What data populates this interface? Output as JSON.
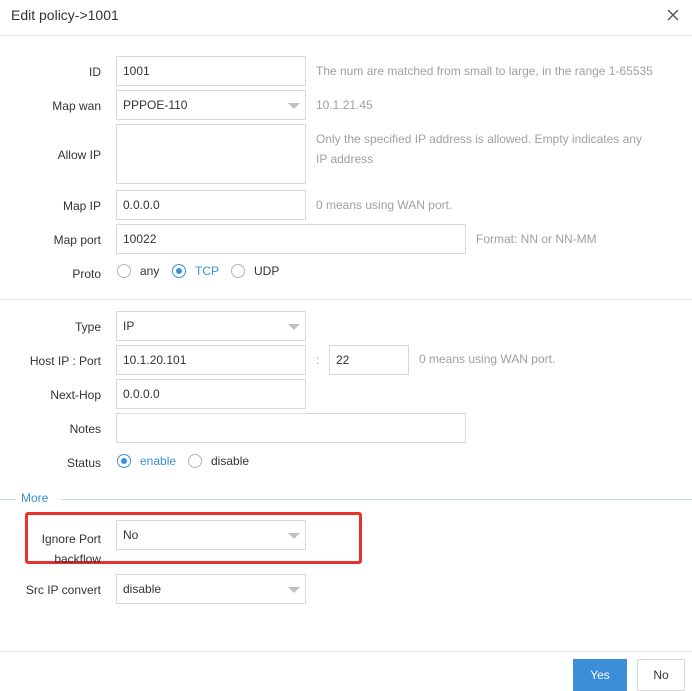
{
  "dialog": {
    "title": "Edit policy->1001",
    "yes_label": "Yes",
    "no_label": "No",
    "more_label": "More"
  },
  "form": {
    "id_label": "ID",
    "id_value": "1001",
    "id_hint": "The num are matched from small to large, in the range 1-65535",
    "mapwan_label": "Map wan",
    "mapwan_value": "PPPOE-110",
    "mapwan_hint": "10.1.21.45",
    "allowip_label": "Allow IP",
    "allowip_value": "",
    "allowip_hint": "Only the specified IP address is allowed. Empty indicates any IP address",
    "mapip_label": "Map IP",
    "mapip_value": "0.0.0.0",
    "mapip_hint": "0 means using WAN port.",
    "mapport_label": "Map port",
    "mapport_value": "10022",
    "mapport_hint": "Format: NN or NN-MM",
    "proto_label": "Proto",
    "proto_options": [
      "any",
      "TCP",
      "UDP"
    ],
    "proto_selected": "TCP",
    "type_label": "Type",
    "type_value": "IP",
    "hostip_label": "Host IP : Port",
    "hostip_value": "10.1.20.101",
    "port_sep": ":",
    "port_value": "22",
    "hostip_hint": "0 means using WAN port.",
    "nexthop_label": "Next-Hop",
    "nexthop_value": "0.0.0.0",
    "notes_label": "Notes",
    "notes_value": "",
    "status_label": "Status",
    "status_options": [
      "enable",
      "disable"
    ],
    "status_selected": "enable",
    "ignoreport_label_1": "Ignore Port",
    "ignoreport_label_2": "backflow",
    "ignoreport_value": "No",
    "srcip_label": "Src IP convert",
    "srcip_value": "disable"
  },
  "colors": {
    "accent": "#3b8fd8",
    "highlight_box": "#e8312a"
  },
  "icons": {
    "close": "close-icon",
    "dropdown": "chevron-down-icon"
  }
}
